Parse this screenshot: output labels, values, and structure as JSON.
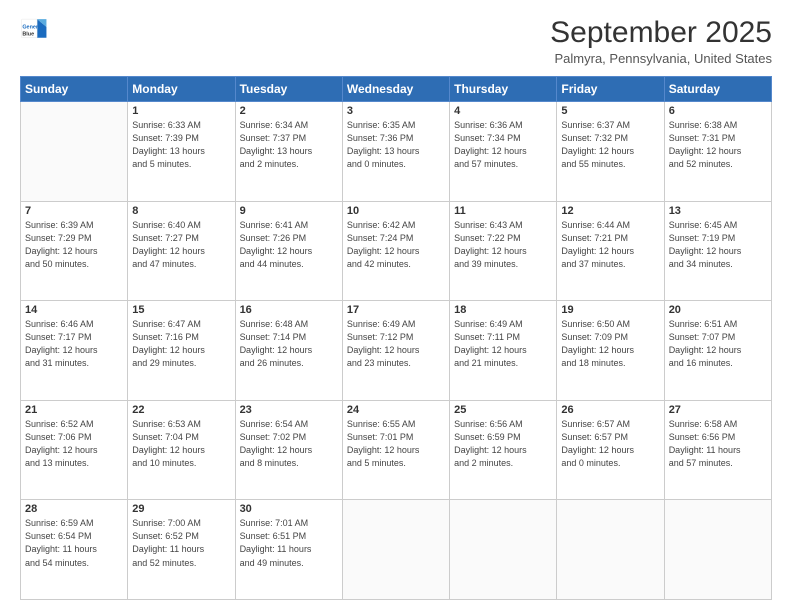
{
  "logo": {
    "line1": "General",
    "line2": "Blue"
  },
  "title": "September 2025",
  "subtitle": "Palmyra, Pennsylvania, United States",
  "days_header": [
    "Sunday",
    "Monday",
    "Tuesday",
    "Wednesday",
    "Thursday",
    "Friday",
    "Saturday"
  ],
  "weeks": [
    [
      {
        "num": "",
        "info": ""
      },
      {
        "num": "1",
        "info": "Sunrise: 6:33 AM\nSunset: 7:39 PM\nDaylight: 13 hours\nand 5 minutes."
      },
      {
        "num": "2",
        "info": "Sunrise: 6:34 AM\nSunset: 7:37 PM\nDaylight: 13 hours\nand 2 minutes."
      },
      {
        "num": "3",
        "info": "Sunrise: 6:35 AM\nSunset: 7:36 PM\nDaylight: 13 hours\nand 0 minutes."
      },
      {
        "num": "4",
        "info": "Sunrise: 6:36 AM\nSunset: 7:34 PM\nDaylight: 12 hours\nand 57 minutes."
      },
      {
        "num": "5",
        "info": "Sunrise: 6:37 AM\nSunset: 7:32 PM\nDaylight: 12 hours\nand 55 minutes."
      },
      {
        "num": "6",
        "info": "Sunrise: 6:38 AM\nSunset: 7:31 PM\nDaylight: 12 hours\nand 52 minutes."
      }
    ],
    [
      {
        "num": "7",
        "info": "Sunrise: 6:39 AM\nSunset: 7:29 PM\nDaylight: 12 hours\nand 50 minutes."
      },
      {
        "num": "8",
        "info": "Sunrise: 6:40 AM\nSunset: 7:27 PM\nDaylight: 12 hours\nand 47 minutes."
      },
      {
        "num": "9",
        "info": "Sunrise: 6:41 AM\nSunset: 7:26 PM\nDaylight: 12 hours\nand 44 minutes."
      },
      {
        "num": "10",
        "info": "Sunrise: 6:42 AM\nSunset: 7:24 PM\nDaylight: 12 hours\nand 42 minutes."
      },
      {
        "num": "11",
        "info": "Sunrise: 6:43 AM\nSunset: 7:22 PM\nDaylight: 12 hours\nand 39 minutes."
      },
      {
        "num": "12",
        "info": "Sunrise: 6:44 AM\nSunset: 7:21 PM\nDaylight: 12 hours\nand 37 minutes."
      },
      {
        "num": "13",
        "info": "Sunrise: 6:45 AM\nSunset: 7:19 PM\nDaylight: 12 hours\nand 34 minutes."
      }
    ],
    [
      {
        "num": "14",
        "info": "Sunrise: 6:46 AM\nSunset: 7:17 PM\nDaylight: 12 hours\nand 31 minutes."
      },
      {
        "num": "15",
        "info": "Sunrise: 6:47 AM\nSunset: 7:16 PM\nDaylight: 12 hours\nand 29 minutes."
      },
      {
        "num": "16",
        "info": "Sunrise: 6:48 AM\nSunset: 7:14 PM\nDaylight: 12 hours\nand 26 minutes."
      },
      {
        "num": "17",
        "info": "Sunrise: 6:49 AM\nSunset: 7:12 PM\nDaylight: 12 hours\nand 23 minutes."
      },
      {
        "num": "18",
        "info": "Sunrise: 6:49 AM\nSunset: 7:11 PM\nDaylight: 12 hours\nand 21 minutes."
      },
      {
        "num": "19",
        "info": "Sunrise: 6:50 AM\nSunset: 7:09 PM\nDaylight: 12 hours\nand 18 minutes."
      },
      {
        "num": "20",
        "info": "Sunrise: 6:51 AM\nSunset: 7:07 PM\nDaylight: 12 hours\nand 16 minutes."
      }
    ],
    [
      {
        "num": "21",
        "info": "Sunrise: 6:52 AM\nSunset: 7:06 PM\nDaylight: 12 hours\nand 13 minutes."
      },
      {
        "num": "22",
        "info": "Sunrise: 6:53 AM\nSunset: 7:04 PM\nDaylight: 12 hours\nand 10 minutes."
      },
      {
        "num": "23",
        "info": "Sunrise: 6:54 AM\nSunset: 7:02 PM\nDaylight: 12 hours\nand 8 minutes."
      },
      {
        "num": "24",
        "info": "Sunrise: 6:55 AM\nSunset: 7:01 PM\nDaylight: 12 hours\nand 5 minutes."
      },
      {
        "num": "25",
        "info": "Sunrise: 6:56 AM\nSunset: 6:59 PM\nDaylight: 12 hours\nand 2 minutes."
      },
      {
        "num": "26",
        "info": "Sunrise: 6:57 AM\nSunset: 6:57 PM\nDaylight: 12 hours\nand 0 minutes."
      },
      {
        "num": "27",
        "info": "Sunrise: 6:58 AM\nSunset: 6:56 PM\nDaylight: 11 hours\nand 57 minutes."
      }
    ],
    [
      {
        "num": "28",
        "info": "Sunrise: 6:59 AM\nSunset: 6:54 PM\nDaylight: 11 hours\nand 54 minutes."
      },
      {
        "num": "29",
        "info": "Sunrise: 7:00 AM\nSunset: 6:52 PM\nDaylight: 11 hours\nand 52 minutes."
      },
      {
        "num": "30",
        "info": "Sunrise: 7:01 AM\nSunset: 6:51 PM\nDaylight: 11 hours\nand 49 minutes."
      },
      {
        "num": "",
        "info": ""
      },
      {
        "num": "",
        "info": ""
      },
      {
        "num": "",
        "info": ""
      },
      {
        "num": "",
        "info": ""
      }
    ]
  ]
}
